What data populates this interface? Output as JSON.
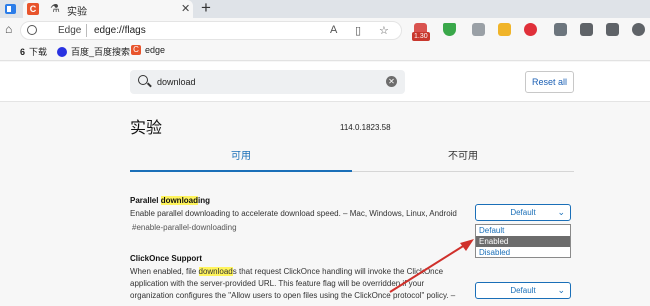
{
  "browser": {
    "tab": {
      "title": "实验",
      "favicon": "C"
    },
    "address": {
      "site_label": "Edge",
      "url": "edge://flags"
    },
    "extension_badge": "1.30",
    "favorites": [
      {
        "label": "下载",
        "icon_text": "6"
      },
      {
        "label": "百度_百度搜索",
        "icon_text": ""
      },
      {
        "label": "edge",
        "icon_text": "C"
      }
    ]
  },
  "search": {
    "value": "download",
    "clear_icon": "close-icon"
  },
  "reset_label": "Reset all",
  "page_title": "实验",
  "version": "114.0.1823.58",
  "tabs": {
    "available": "可用",
    "unavailable": "不可用"
  },
  "flags": [
    {
      "name_pre": "Parallel ",
      "name_hl": "download",
      "name_post": "ing",
      "description": "Enable parallel downloading to accelerate download speed. – Mac, Windows, Linux, Android",
      "link": "#enable-parallel-downloading",
      "selected": "Default",
      "options": [
        "Default",
        "Enabled",
        "Disabled"
      ],
      "highlighted_option": "Enabled"
    },
    {
      "name": "ClickOnce Support",
      "desc_pre": "When enabled, file ",
      "desc_hl": "download",
      "desc_line1_post": "s that request ClickOnce handling will invoke the ClickOnce",
      "desc_line2": "application with the server-provided URL. This feature flag will be overridden if your",
      "desc_line3": "organization configures the \"Allow users to open files using the ClickOnce protocol\" policy. –",
      "selected": "Default"
    }
  ],
  "colors": {
    "accent": "#1a6fb8",
    "highlight": "#fff45c",
    "arrow": "#d0302b"
  }
}
